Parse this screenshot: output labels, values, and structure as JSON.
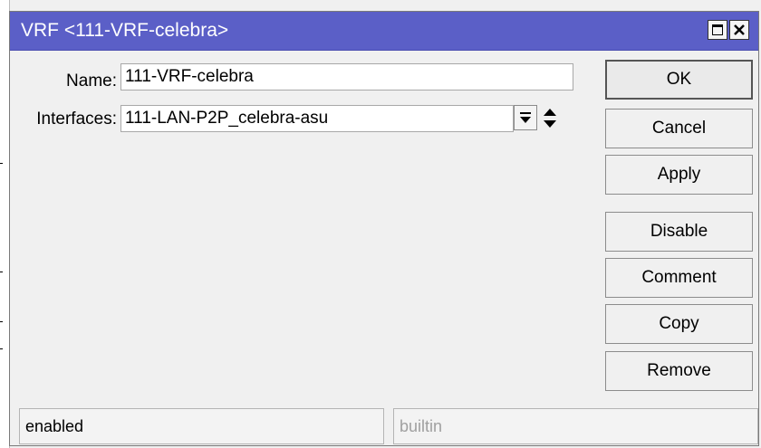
{
  "window": {
    "title": "VRF <111-VRF-celebra>",
    "titlebar_color": "#5b5fc7"
  },
  "form": {
    "name_label": "Name:",
    "name_value": "111-VRF-celebra",
    "interfaces_label": "Interfaces:",
    "interfaces_value": "111-LAN-P2P_celebra-asu"
  },
  "buttons": {
    "ok": "OK",
    "cancel": "Cancel",
    "apply": "Apply",
    "disable": "Disable",
    "comment": "Comment",
    "copy": "Copy",
    "remove": "Remove"
  },
  "status": {
    "state": "enabled",
    "origin": "builtin"
  },
  "icons": {
    "maximize": "maximize-icon",
    "close": "close-icon",
    "dropdown": "dropdown-icon",
    "reorder": "up-down-arrows-icon"
  }
}
